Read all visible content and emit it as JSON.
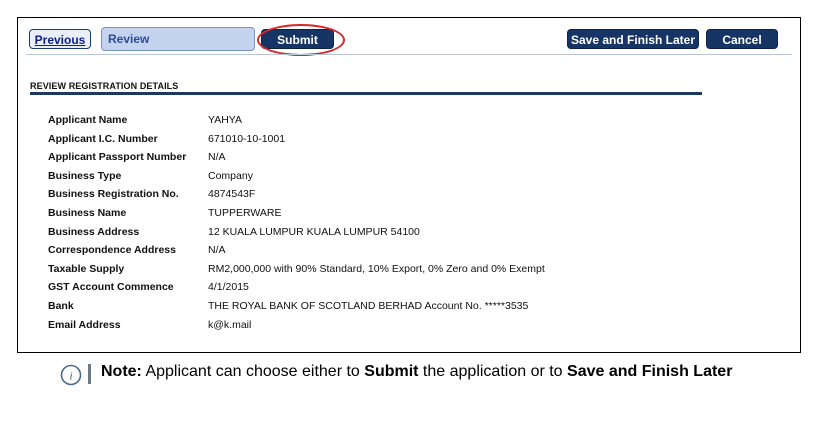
{
  "toolbar": {
    "previous_label": "Previous",
    "review_label": "Review",
    "submit_label": "Submit",
    "save_finish_label": "Save and Finish Later",
    "cancel_label": "Cancel"
  },
  "section": {
    "title": "REVIEW REGISTRATION DETAILS"
  },
  "details": [
    {
      "label": "Applicant Name",
      "value": "YAHYA"
    },
    {
      "label": "Applicant I.C. Number",
      "value": "671010-10-1001"
    },
    {
      "label": "Applicant Passport Number",
      "value": "N/A"
    },
    {
      "label": "Business Type",
      "value": "Company"
    },
    {
      "label": "Business Registration No.",
      "value": "4874543F"
    },
    {
      "label": "Business Name",
      "value": "TUPPERWARE"
    },
    {
      "label": "Business Address",
      "value": "12 KUALA LUMPUR KUALA LUMPUR 54100"
    },
    {
      "label": "Correspondence Address",
      "value": "N/A"
    },
    {
      "label": "Taxable Supply",
      "value": "RM2,000,000 with 90% Standard, 10% Export, 0% Zero and 0% Exempt"
    },
    {
      "label": "GST Account Commence",
      "value": "4/1/2015"
    },
    {
      "label": "Bank",
      "value": "THE ROYAL BANK OF SCOTLAND BERHAD Account No. *****3535"
    },
    {
      "label": "Email Address",
      "value": "k@k.mail"
    }
  ],
  "note": {
    "prefix": "Note:",
    "text1": " Applicant can choose either to ",
    "bold1": "Submit",
    "text2": " the application or to ",
    "bold2": "Save and Finish Later"
  },
  "colors": {
    "button_bg": "#163564",
    "highlight": "#d62828",
    "section_bar": "#1c3a60"
  },
  "icons": {
    "note_icon": "info-icon"
  }
}
